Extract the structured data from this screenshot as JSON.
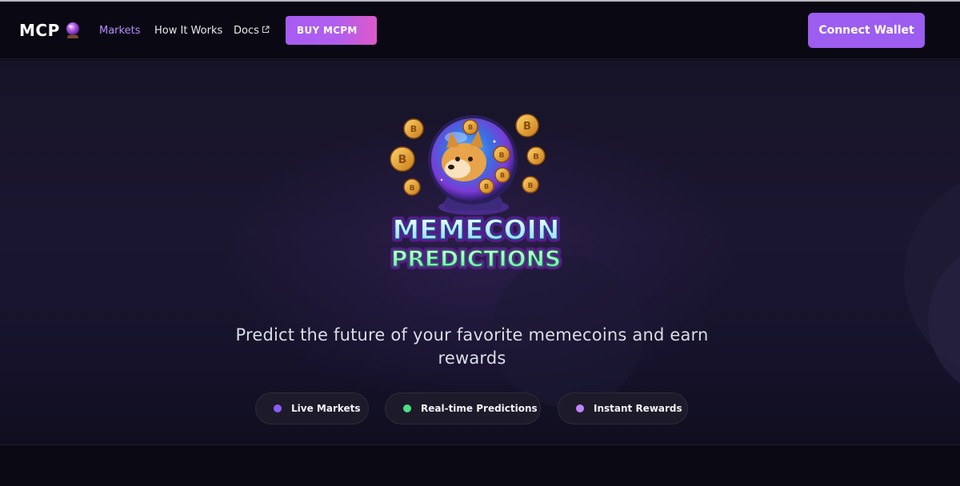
{
  "nav": {
    "brand": "MCP",
    "links": [
      {
        "label": "Markets",
        "active": true
      },
      {
        "label": "How It Works",
        "active": false
      },
      {
        "label": "Docs",
        "active": false,
        "external": true
      }
    ],
    "buy_label": "BUY MCPM",
    "connect_label": "Connect Wallet"
  },
  "hero": {
    "logo_line1": "MEMECOIN",
    "logo_line2": "PREDICTIONS",
    "tagline_line1": "Predict the future of your favorite memecoins and earn",
    "tagline_line2": "rewards",
    "features": [
      {
        "label": "Live Markets",
        "dot_color": "#8b5cf6"
      },
      {
        "label": "Real-time Predictions",
        "dot_color": "#4ade80"
      },
      {
        "label": "Instant Rewards",
        "dot_color": "#c084fc"
      }
    ]
  },
  "colors": {
    "accent": "#9c5df0",
    "active_link": "#b78bff",
    "background": "#0c0a16"
  }
}
